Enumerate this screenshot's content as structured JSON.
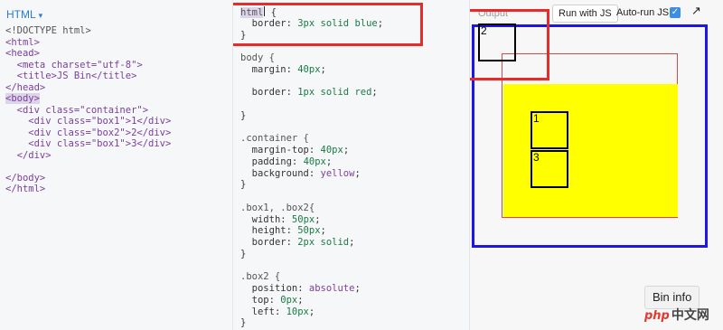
{
  "html_panel": {
    "tab_label": "HTML",
    "caret": "▾",
    "lines": [
      "<!DOCTYPE html>",
      "<html>",
      "<head>",
      "  <meta charset=\"utf-8\">",
      "  <title>JS Bin</title>",
      "</head>",
      "<body>",
      "  <div class=\"container\">",
      "    <div class=\"box1\">1</div>",
      "    <div class=\"box2\">2</div>",
      "    <div class=\"box1\">3</div>",
      "  </div>",
      "",
      "</body>",
      "</html>"
    ]
  },
  "css_panel": {
    "html_selector": "html",
    "html_brace": " {",
    "html_decl_prop": "border: ",
    "html_decl_value": "3px solid blue",
    "body_selector": "body {",
    "body_margin_prop": "margin: ",
    "body_margin_value": "40px",
    "body_border_prop": "border: ",
    "body_border_value": "1px solid red",
    "container_selector": ".container {",
    "container_margin_prop": "margin-top: ",
    "container_margin_value": "40px",
    "container_padding_prop": "padding: ",
    "container_padding_value": "40px",
    "container_bg_prop": "background: ",
    "container_bg_value": "yellow",
    "boxes_selector": ".box1, .box2{",
    "boxes_width_prop": "width: ",
    "boxes_width_value": "50px",
    "boxes_height_prop": "height: ",
    "boxes_height_value": "50px",
    "boxes_border_prop": "border: ",
    "boxes_border_value": "2px solid",
    "box2_selector": ".box2 {",
    "box2_position_prop": "position: ",
    "box2_position_value": "absolute",
    "box2_top_prop": "top: ",
    "box2_top_value": "0px",
    "box2_left_prop": "left: ",
    "box2_left_value": "10px",
    "close_brace": "}",
    "semicolon": ";"
  },
  "output_panel": {
    "label": "Output",
    "run_button": "Run with JS",
    "autorun_label": "Auto-run JS",
    "autorun_checked": "✓",
    "popout_icon": "↗",
    "box_labels": [
      "1",
      "2",
      "3"
    ],
    "bin_info_button": "Bin info"
  },
  "watermark": {
    "php": "php",
    "cn": "中文网"
  },
  "colors": {
    "annotation_red": "#e62b2b",
    "html_border_blue": "#1d16e6",
    "body_border_red": "#e84343",
    "container_yellow": "#ffff00",
    "accent_blue": "#2a7bd3"
  }
}
